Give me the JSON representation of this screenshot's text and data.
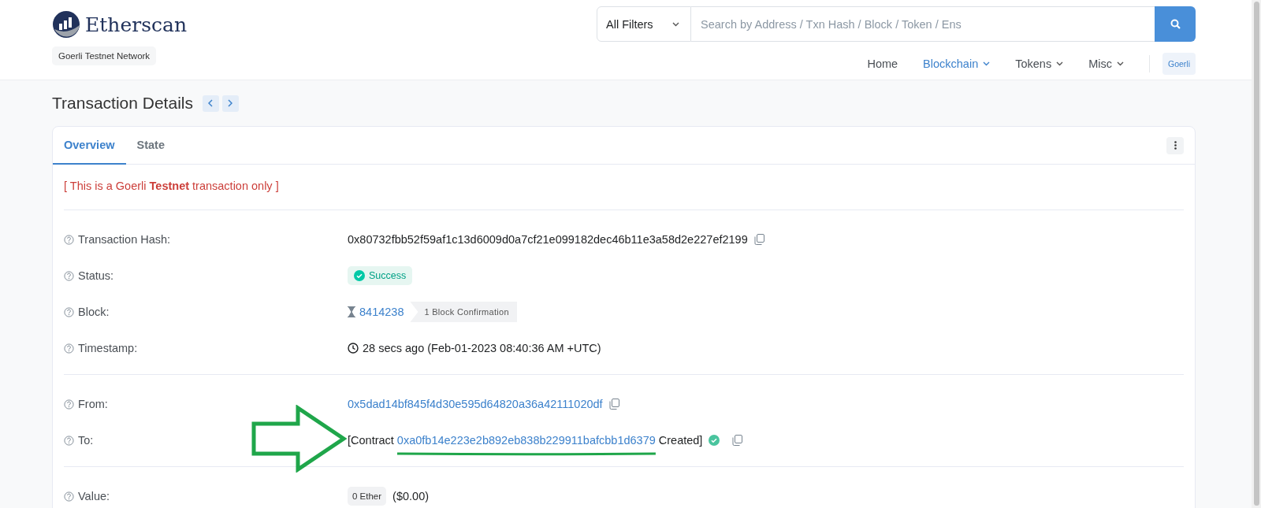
{
  "header": {
    "logo_text": "Etherscan",
    "network_badge": "Goerli Testnet Network",
    "search": {
      "filter": "All Filters",
      "placeholder": "Search by Address / Txn Hash / Block / Token / Ens"
    },
    "nav": [
      {
        "label": "Home",
        "selected": false,
        "dropdown": false
      },
      {
        "label": "Blockchain",
        "selected": true,
        "dropdown": true
      },
      {
        "label": "Tokens",
        "selected": false,
        "dropdown": true
      },
      {
        "label": "Misc",
        "selected": false,
        "dropdown": true
      }
    ],
    "network_button": "Goerli"
  },
  "title": "Transaction Details",
  "tabs": [
    {
      "label": "Overview",
      "selected": true
    },
    {
      "label": "State",
      "selected": false
    }
  ],
  "notice": "[ This is a Goerli **Testnet** transaction only ]",
  "sections": [
    {
      "rows": [
        {
          "kind": "text",
          "label": "Transaction Hash:",
          "value": "0x80732fbb52f59af1c13d6009d0a7cf21e099182dec46b11e3a58d2e227ef2199",
          "copy": true
        },
        {
          "kind": "status",
          "label": "Status:",
          "value": "Success"
        },
        {
          "kind": "block",
          "label": "Block:",
          "value": "8414238",
          "confirmation": "1 Block Confirmation"
        },
        {
          "kind": "time",
          "label": "Timestamp:",
          "value": "28 secs ago (Feb-01-2023 08:40:36 AM +UTC)"
        }
      ]
    },
    {
      "rows": [
        {
          "kind": "link",
          "label": "From:",
          "value": "0x5dad14bf845f4d30e595d64820a36a42111020df",
          "copy": true
        },
        {
          "kind": "contract",
          "label": "To:",
          "prefix": "[Contract",
          "value": "0xa0fb14e223e2b892eb838b229911bafcbb1d6379",
          "suffix": "Created]",
          "verified": true,
          "copy": true,
          "highlighted": true
        }
      ]
    },
    {
      "rows": [
        {
          "kind": "amount",
          "label": "Value:",
          "badge": "0 Ether",
          "value": "($0.00)"
        }
      ]
    }
  ]
}
